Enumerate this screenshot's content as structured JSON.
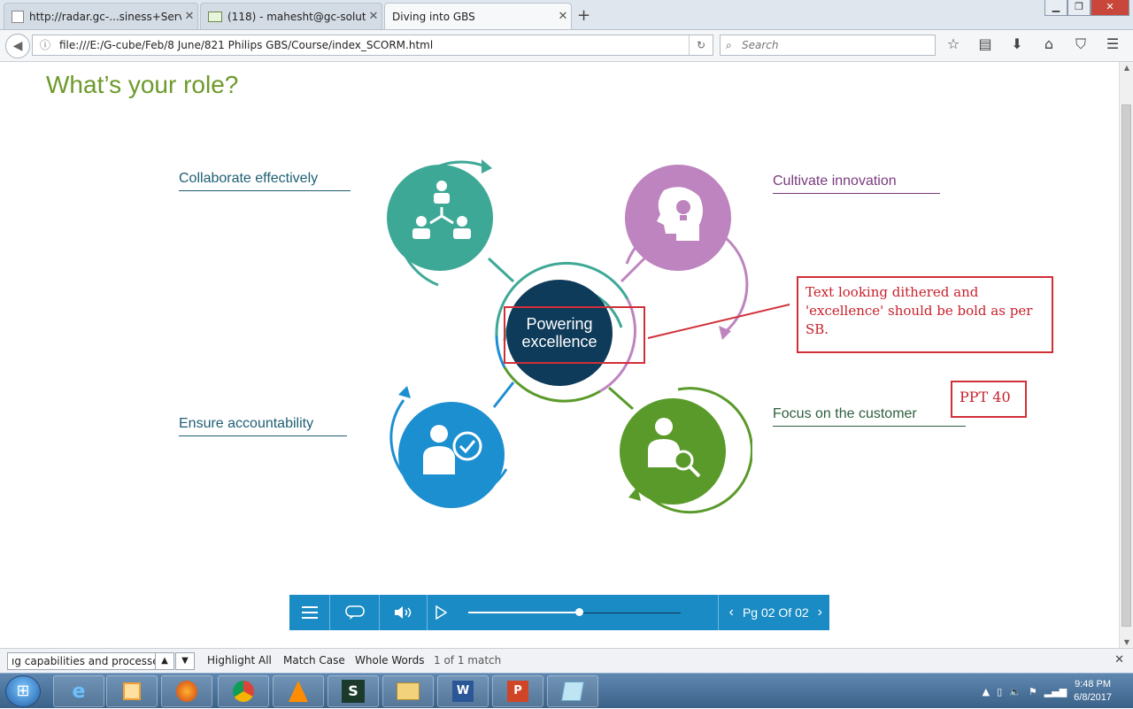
{
  "browser": {
    "tabs": [
      {
        "title": "http://radar.gc-...siness+Services",
        "active": false
      },
      {
        "title": "(118) - mahesht@gc-soluti...",
        "active": false
      },
      {
        "title": "Diving into GBS",
        "active": true
      }
    ],
    "new_tab_label": "+",
    "url": "file:///E:/G-cube/Feb/8 June/821 Philips GBS/Course/index_SCORM.html",
    "search_placeholder": "Search"
  },
  "page": {
    "title": "What’s your role?",
    "center_label_line1": "Powering",
    "center_label_line2": "excellence",
    "labels": {
      "collaborate": "Collaborate effectively",
      "innovate": "Cultivate innovation",
      "accountability": "Ensure accountability",
      "customer": "Focus on the customer"
    },
    "annotation": "Text looking dithered and 'excellence' should be bold as per SB.",
    "ppt_tag": "PPT 40"
  },
  "player": {
    "progress": 0.52,
    "page_indicator": "Pg 02 Of 02"
  },
  "findbar": {
    "query": "ıg capabilities and processes?",
    "highlight_all": "Highlight All",
    "match_case": "Match Case",
    "whole_words": "Whole Words",
    "status": "1 of 1 match"
  },
  "taskbar": {
    "time": "9:48 PM",
    "date": "6/8/2017"
  },
  "colors": {
    "teal": "#3ea897",
    "purple": "#be84bf",
    "blue": "#1c8fd0",
    "green": "#5a9a2a",
    "navy": "#0e3b5a",
    "title_green": "#6d9a2c",
    "annotation_red": "#d12f38",
    "player_blue": "#1a8bc4"
  }
}
